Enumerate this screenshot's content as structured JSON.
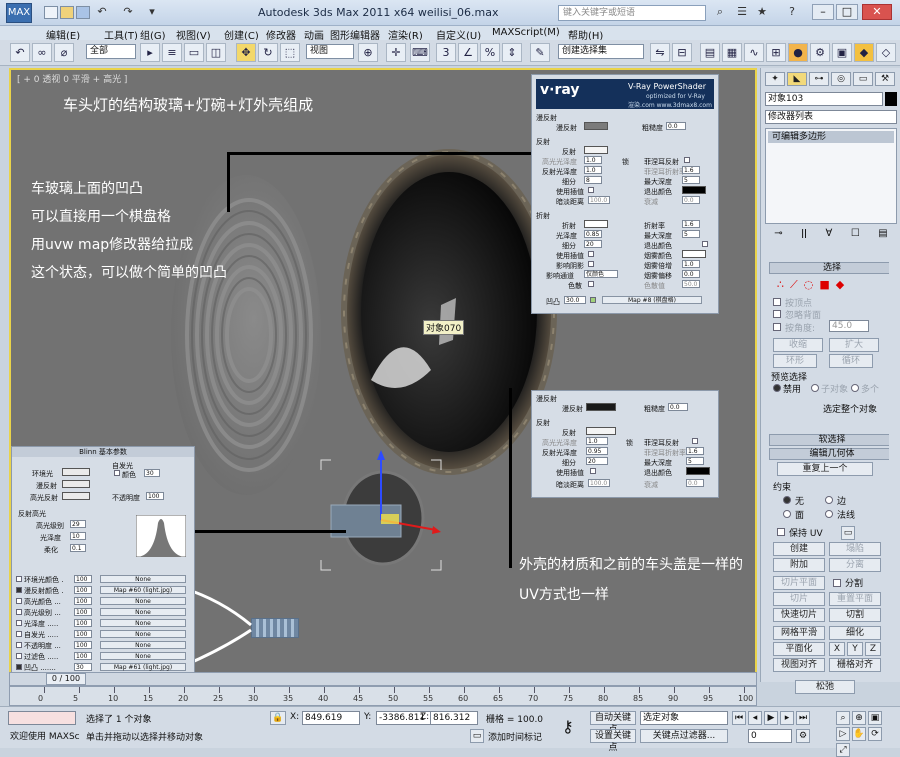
{
  "app": {
    "title": "Autodesk 3ds Max  2011 x64    weilisi_06.max",
    "search_placeholder": "键入关键字或短语",
    "icon_label": "MAX"
  },
  "menu": [
    "编辑(E)",
    "工具(T)",
    "组(G)",
    "视图(V)",
    "创建(C)",
    "修改器",
    "动画",
    "图形编辑器",
    "渲染(R)",
    "自定义(U)",
    "MAXScript(M)",
    "帮助(H)"
  ],
  "toolbar": {
    "filter": "全部",
    "view": "视图",
    "selection_set": "创建选择集"
  },
  "viewport": {
    "label": "[ + 0 透视 0 平滑 + 高光 ]",
    "note_title": "车头灯的结构玻璃+灯碗+灯外壳组成",
    "note_lines": [
      "车玻璃上面的凹凸",
      "可以直接用一个棋盘格",
      "用uvw map修改器给拉成",
      "这个状态，可以做个简单的凹凸"
    ],
    "note_bottom": [
      "外壳的材质和之前的车头盖是一样的",
      "UV方式也一样"
    ],
    "object_tag": "对象070"
  },
  "vray_panel": {
    "logo": "v·ray",
    "header": "V-Ray PowerShader",
    "sub": "optimized for V-Ray",
    "site": "渲染.com  www.3dmax8.com",
    "diffuse": "漫反射",
    "diffuse_label": "漫反射",
    "roughness": "粗糙度",
    "roughness_val": "0.0",
    "reflect_head": "反射",
    "reflect": "反射",
    "hilight_gloss": "高光光泽度",
    "hilight_val": "1.0",
    "lock": "锁",
    "fresnel": "菲涅耳反射",
    "refl_gloss": "反射光泽度",
    "refl_gloss_val": "1.0",
    "fresnel_ior": "菲涅耳折射率",
    "fresnel_ior_val": "1.6",
    "subdivs": "细分",
    "subdivs_val": "8",
    "max_depth": "最大深度",
    "max_depth_val": "5",
    "use_interp": "使用插值",
    "exit_color": "退出颜色",
    "dim_dist": "暗淡距离",
    "dim_dist_val": "100.0",
    "dim_falloff": "衰减",
    "dim_falloff_val": "0.0",
    "refract_head": "折射",
    "refract": "折射",
    "ior": "折射率",
    "ior_val": "1.6",
    "glossiness": "光泽度",
    "gloss_val": "0.85",
    "max_depth2_val": "5",
    "subdivs2_val": "20",
    "fog_color": "烟雾颜色",
    "affect_shadows": "影响阴影",
    "fog_mult": "烟雾倍增",
    "fog_mult_val": "1.0",
    "affect_ch": "影响通道",
    "affect_ch_val": "仅颜色",
    "fog_bias": "烟雾偏移",
    "fog_bias_val": "0.0",
    "dispersion": "色散",
    "abbe": "色散值",
    "abbe_val": "50.0",
    "bump": "凹凸",
    "bump_val": "30.0",
    "bump_map": "Map #8 (棋盘格)"
  },
  "vray_panel2": {
    "diffuse": "漫反射",
    "diffuse_label": "漫反射",
    "roughness": "粗糙度",
    "roughness_val": "0.0",
    "reflect_head": "反射",
    "reflect": "反射",
    "hilight_gloss": "高光光泽度",
    "hilight_val": "1.0",
    "lock": "锁",
    "fresnel": "菲涅耳反射",
    "refl_gloss": "反射光泽度",
    "refl_gloss_val": "0.95",
    "fresnel_ior": "菲涅耳折射率",
    "fresnel_ior_val": "1.6",
    "subdivs": "细分",
    "subdivs_val": "20",
    "max_depth": "最大深度",
    "max_depth_val": "5",
    "use_interp": "使用插值",
    "exit_color": "退出颜色",
    "dim_dist": "暗淡距离",
    "dim_dist_val": "100.0",
    "dim_falloff": "衰减",
    "dim_falloff_val": "0.0"
  },
  "blinn_panel": {
    "title": "Blinn 基本参数",
    "self_illum": "自发光",
    "color": "颜色",
    "color_val": "30",
    "ambient": "环境光",
    "diffuse": "漫反射",
    "specular": "高光反射",
    "opacity": "不透明度",
    "opacity_val": "100",
    "spec_head": "反射高光",
    "spec_level": "高光级别",
    "spec_level_val": "29",
    "glossiness": "光泽度",
    "gloss_val": "10",
    "soften": "柔化",
    "soften_val": "0.1"
  },
  "maps": [
    {
      "name": "环境光颜色 .",
      "amount": "100",
      "map": "None",
      "checked": false
    },
    {
      "name": "漫反射颜色 .",
      "amount": "100",
      "map": "Map #60 (light.jpg)",
      "checked": true
    },
    {
      "name": "高光颜色 ...",
      "amount": "100",
      "map": "None",
      "checked": false
    },
    {
      "name": "高光级别 ...",
      "amount": "100",
      "map": "None",
      "checked": false
    },
    {
      "name": "光泽度 .....",
      "amount": "100",
      "map": "None",
      "checked": false
    },
    {
      "name": "自发光 .....",
      "amount": "100",
      "map": "None",
      "checked": false
    },
    {
      "name": "不透明度 ...",
      "amount": "100",
      "map": "None",
      "checked": false
    },
    {
      "name": "过滤色 .....",
      "amount": "100",
      "map": "None",
      "checked": false
    },
    {
      "name": "凹凸 .......",
      "amount": "30",
      "map": "Map #61 (light.jpg)",
      "checked": true
    }
  ],
  "cmdpanel": {
    "object_name": "对象103",
    "modifier_list": "修改器列表",
    "stack_item": "可编辑多边形",
    "selection_head": "选择",
    "by_vertex": "按顶点",
    "ignore_backfacing": "忽略背面",
    "by_angle": "按角度:",
    "angle_val": "45.0",
    "shrink": "收缩",
    "grow": "扩大",
    "ring": "环形",
    "loop": "循环",
    "preview_selection": "预览选择",
    "disabled": "禁用",
    "subobject": "子对象",
    "multi": "多个",
    "selected_whole": "选定整个对象",
    "soft_selection": "软选择",
    "edit_geometry": "编辑几何体",
    "repeat_last": "重复上一个",
    "constraints": "约束",
    "c_none": "无",
    "c_edge": "边",
    "c_face": "面",
    "c_normal": "法线",
    "preserve_uv": "保持 UV",
    "create": "创建",
    "collapse": "塌陷",
    "attach": "附加",
    "detach": "分离",
    "slice_plane": "切片平面",
    "split": "分割",
    "slice": "切片",
    "reset_plane": "重置平面",
    "quickslice": "快速切片",
    "cut": "切割",
    "meshsmooth": "网格平滑",
    "tessellate": "细化",
    "make_planar": "平面化",
    "x": "X",
    "y": "Y",
    "z": "Z",
    "view_align": "视图对齐",
    "grid_align": "栅格对齐",
    "relax": "松弛"
  },
  "timeslider": {
    "label": "0 / 100",
    "ticks": [
      "0",
      "5",
      "10",
      "15",
      "20",
      "25",
      "30",
      "35",
      "40",
      "45",
      "50",
      "55",
      "60",
      "65",
      "70",
      "75",
      "80",
      "85",
      "90",
      "95",
      "100"
    ]
  },
  "status": {
    "welcome": "欢迎使用 MAXSc",
    "selected": "选择了 1 个对象",
    "prompt": "单击并拖动以选择并移动对象",
    "x_label": "X:",
    "x_val": "849.619",
    "y_label": "Y:",
    "y_val": "-3386.811",
    "z_label": "Z:",
    "z_val": "816.312",
    "grid": "栅格 = 100.0",
    "add_time_tag": "添加时间标记",
    "auto_key": "自动关键点",
    "set_key": "设置关键点",
    "selected_obj": "选定对象",
    "key_filters": "关键点过滤器...",
    "frame_val": "0"
  },
  "colors": {
    "accent": "#e9d34a",
    "viewport_bg": "#727272",
    "note_text": "#ffffff"
  }
}
